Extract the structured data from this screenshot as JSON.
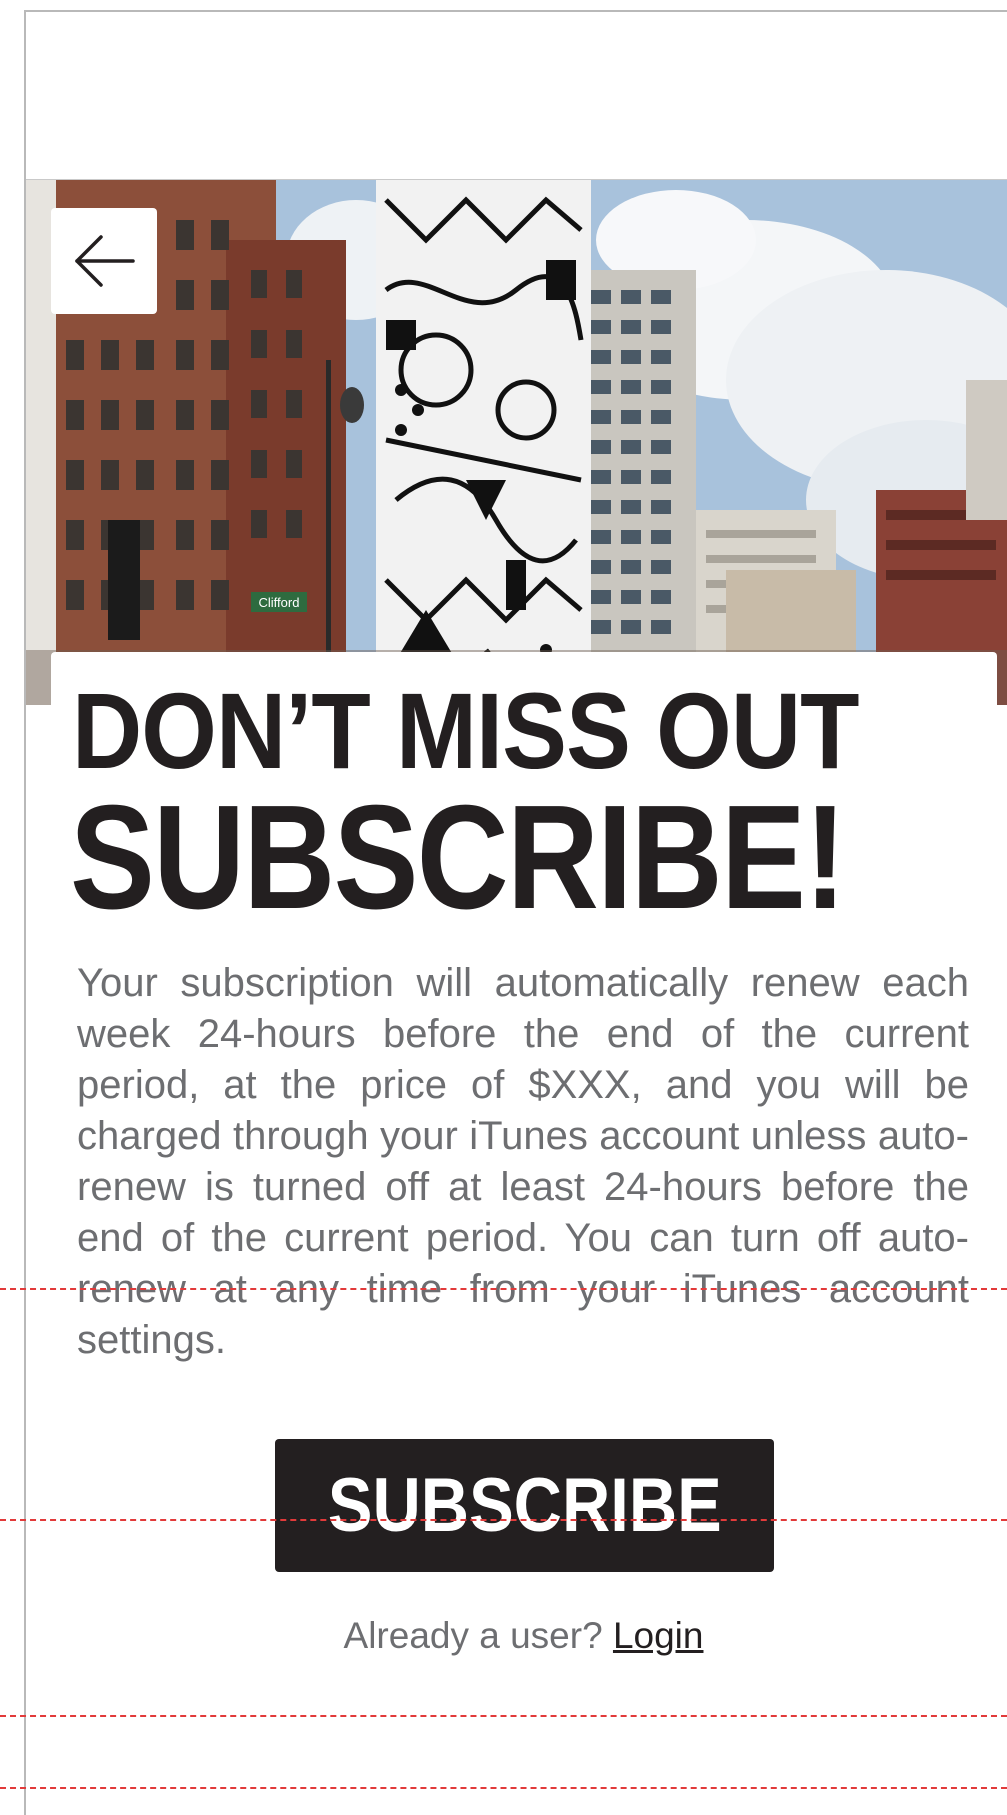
{
  "header": {
    "back_icon": "arrow-left-icon"
  },
  "hero": {
    "street_sign": "Clifford"
  },
  "content": {
    "headline_line1": "DON’T MISS OUT",
    "headline_line2": "SUBSCRIBE!",
    "body": "Your subscription will automatically renew each week 24-hours before the end of the current period, at the price of $XXX, and you will be charged through your iTunes account unless auto-renew is turned off at least 24-hours before the end of the current period. You can turn off auto-renew at any time from your iTunes account settings."
  },
  "actions": {
    "subscribe_label": "SUBSCRIBE",
    "login_prompt": "Already a user?",
    "login_label": "Login"
  },
  "colors": {
    "text_dark": "#231f20",
    "text_body": "#6d6e71",
    "guide_line": "#e23a3a",
    "frame": "#b9b9b9"
  }
}
